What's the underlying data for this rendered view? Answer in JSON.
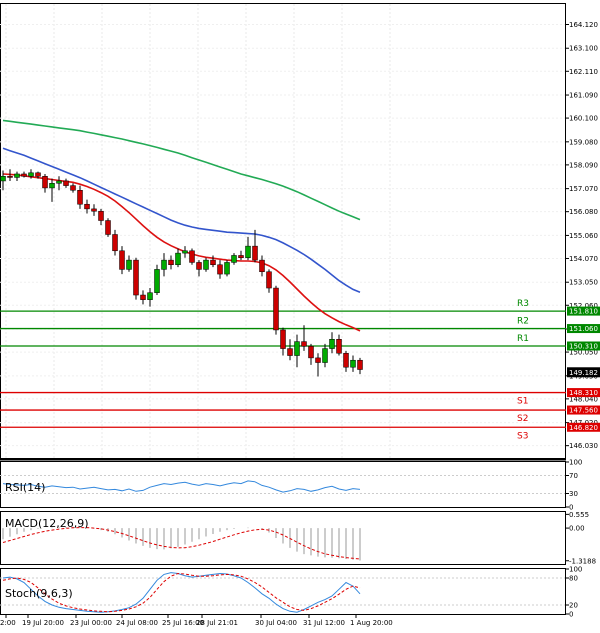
{
  "chart_data": {
    "type": "candlestick",
    "price": {
      "ylim": [
        145.5,
        165.0
      ],
      "yticks": [
        "164.120",
        "163.100",
        "162.110",
        "161.090",
        "160.100",
        "159.080",
        "158.090",
        "157.070",
        "156.080",
        "155.060",
        "154.070",
        "153.050",
        "152.060",
        "151.040",
        "150.050",
        "149.030",
        "148.040",
        "147.020",
        "146.030"
      ],
      "xlabels": [
        "2:00",
        "19 Jul 20:00",
        "23 Jul 00:00",
        "24 Jul 08:00",
        "25 Jul 16:00",
        "28 Jul 21:01",
        "30 Jul 04:00",
        "31 Jul 12:00",
        "1 Aug 20:00"
      ],
      "candles": [
        [
          157.4,
          157.85,
          157.0,
          157.6
        ],
        [
          157.6,
          157.9,
          157.4,
          157.55
        ],
        [
          157.55,
          157.8,
          157.4,
          157.7
        ],
        [
          157.7,
          157.8,
          157.55,
          157.6
        ],
        [
          157.6,
          157.9,
          157.5,
          157.75
        ],
        [
          157.75,
          157.8,
          157.5,
          157.6
        ],
        [
          157.6,
          157.7,
          156.9,
          157.1
        ],
        [
          157.1,
          157.5,
          156.5,
          157.3
        ],
        [
          157.3,
          157.6,
          157.0,
          157.4
        ],
        [
          157.4,
          157.5,
          157.1,
          157.2
        ],
        [
          157.2,
          157.3,
          156.9,
          157.0
        ],
        [
          157.0,
          157.2,
          156.2,
          156.4
        ],
        [
          156.4,
          156.6,
          156.0,
          156.2
        ],
        [
          156.2,
          156.4,
          155.9,
          156.1
        ],
        [
          156.1,
          156.2,
          155.5,
          155.7
        ],
        [
          155.7,
          155.8,
          155.0,
          155.1
        ],
        [
          155.1,
          155.3,
          154.2,
          154.4
        ],
        [
          154.4,
          154.6,
          153.4,
          153.6
        ],
        [
          153.6,
          154.2,
          153.5,
          154.0
        ],
        [
          154.0,
          154.1,
          152.3,
          152.5
        ],
        [
          152.5,
          152.7,
          152.1,
          152.3
        ],
        [
          152.3,
          152.8,
          152.0,
          152.6
        ],
        [
          152.6,
          153.8,
          152.5,
          153.6
        ],
        [
          153.6,
          154.3,
          153.3,
          154.0
        ],
        [
          154.0,
          154.2,
          153.6,
          153.8
        ],
        [
          153.8,
          154.5,
          153.7,
          154.3
        ],
        [
          154.3,
          154.6,
          154.1,
          154.4
        ],
        [
          154.4,
          154.5,
          153.8,
          153.9
        ],
        [
          153.9,
          154.0,
          153.3,
          153.6
        ],
        [
          153.6,
          154.1,
          153.5,
          154.0
        ],
        [
          154.0,
          154.2,
          153.7,
          153.8
        ],
        [
          153.8,
          154.0,
          153.2,
          153.4
        ],
        [
          153.4,
          154.0,
          153.3,
          153.9
        ],
        [
          153.9,
          154.3,
          153.8,
          154.2
        ],
        [
          154.2,
          154.4,
          154.0,
          154.1
        ],
        [
          154.1,
          155.0,
          154.0,
          154.6
        ],
        [
          154.6,
          155.3,
          153.9,
          154.0
        ],
        [
          154.0,
          154.2,
          153.3,
          153.5
        ],
        [
          153.5,
          153.6,
          152.6,
          152.8
        ],
        [
          152.8,
          152.9,
          150.8,
          151.0
        ],
        [
          151.0,
          151.1,
          149.9,
          150.2
        ],
        [
          150.2,
          150.6,
          149.7,
          149.9
        ],
        [
          149.9,
          150.8,
          149.4,
          150.5
        ],
        [
          150.5,
          151.2,
          150.1,
          150.3
        ],
        [
          150.3,
          150.4,
          149.5,
          149.8
        ],
        [
          149.8,
          150.0,
          149.0,
          149.6
        ],
        [
          149.6,
          150.4,
          149.4,
          150.2
        ],
        [
          150.2,
          150.9,
          150.0,
          150.6
        ],
        [
          150.6,
          150.8,
          149.9,
          150.0
        ],
        [
          150.0,
          150.1,
          149.2,
          149.4
        ],
        [
          149.4,
          149.9,
          149.2,
          149.7
        ],
        [
          149.7,
          149.8,
          149.1,
          149.3
        ]
      ],
      "ma_slow": {
        "color": "#22aa55",
        "values": [
          160.0,
          159.96,
          159.92,
          159.88,
          159.84,
          159.8,
          159.76,
          159.72,
          159.68,
          159.64,
          159.6,
          159.56,
          159.5,
          159.44,
          159.38,
          159.32,
          159.26,
          159.2,
          159.13,
          159.06,
          158.99,
          158.92,
          158.84,
          158.76,
          158.68,
          158.6,
          158.5,
          158.4,
          158.3,
          158.2,
          158.1,
          158.0,
          157.9,
          157.8,
          157.7,
          157.62,
          157.54,
          157.46,
          157.37,
          157.28,
          157.18,
          157.06,
          156.94,
          156.8,
          156.66,
          156.52,
          156.38,
          156.24,
          156.1,
          155.98,
          155.86,
          155.74
        ]
      },
      "ma_mid": {
        "color": "#3355cc",
        "values": [
          158.8,
          158.7,
          158.6,
          158.5,
          158.38,
          158.26,
          158.14,
          158.02,
          157.9,
          157.78,
          157.66,
          157.54,
          157.4,
          157.26,
          157.12,
          156.98,
          156.84,
          156.7,
          156.56,
          156.42,
          156.28,
          156.14,
          156.0,
          155.86,
          155.72,
          155.6,
          155.5,
          155.42,
          155.36,
          155.32,
          155.28,
          155.24,
          155.2,
          155.18,
          155.16,
          155.14,
          155.12,
          155.06,
          154.98,
          154.88,
          154.74,
          154.58,
          154.42,
          154.24,
          154.04,
          153.82,
          153.6,
          153.36,
          153.12,
          152.92,
          152.74,
          152.62
        ]
      },
      "ma_fast": {
        "color": "#dd1111",
        "values": [
          157.7,
          157.68,
          157.66,
          157.62,
          157.58,
          157.54,
          157.5,
          157.46,
          157.42,
          157.38,
          157.34,
          157.26,
          157.16,
          157.04,
          156.9,
          156.74,
          156.54,
          156.3,
          156.04,
          155.76,
          155.48,
          155.22,
          154.98,
          154.78,
          154.62,
          154.48,
          154.36,
          154.26,
          154.18,
          154.12,
          154.08,
          154.04,
          154.0,
          153.98,
          153.96,
          153.96,
          153.94,
          153.88,
          153.76,
          153.58,
          153.34,
          153.06,
          152.76,
          152.46,
          152.18,
          151.92,
          151.7,
          151.52,
          151.36,
          151.22,
          151.1,
          150.96
        ]
      },
      "resistance": [
        {
          "label": "R3",
          "value": "151.810",
          "v": 151.81
        },
        {
          "label": "R2",
          "value": "151.060",
          "v": 151.06
        },
        {
          "label": "R1",
          "value": "150.310",
          "v": 150.31
        }
      ],
      "support": [
        {
          "label": "S1",
          "value": "148.310",
          "v": 148.31
        },
        {
          "label": "S2",
          "value": "147.560",
          "v": 147.56
        },
        {
          "label": "S3",
          "value": "146.820",
          "v": 146.82
        }
      ],
      "current": {
        "value": "149.182",
        "v": 149.182
      },
      "resistance_color": "#008800",
      "support_color": "#dd0000",
      "bull_color": "#00aa00",
      "bear_color": "#cc0000"
    },
    "rsi": {
      "title": "RSI(14)",
      "yticks": [
        "100",
        "70",
        "30",
        "0"
      ],
      "ylim": [
        0,
        100
      ],
      "color": "#3388dd",
      "values": [
        52,
        50,
        49,
        48,
        50,
        46,
        44,
        47,
        45,
        43,
        44,
        40,
        42,
        44,
        41,
        38,
        39,
        36,
        40,
        35,
        37,
        44,
        48,
        52,
        50,
        53,
        55,
        51,
        48,
        52,
        50,
        47,
        51,
        54,
        52,
        58,
        56,
        48,
        44,
        38,
        33,
        36,
        41,
        39,
        35,
        38,
        43,
        46,
        40,
        37,
        41,
        39
      ]
    },
    "macd": {
      "title": "MACD(12,26,9)",
      "yticks": [
        "0.555",
        "0.00",
        "-1.3188"
      ],
      "ylim": [
        -1.45,
        0.65
      ],
      "signal_color": "#dd0000",
      "hist": [
        -0.45,
        -0.35,
        -0.25,
        -0.15,
        -0.08,
        -0.03,
        0.0,
        0.02,
        0.03,
        0.04,
        0.05,
        0.04,
        0.02,
        -0.02,
        -0.08,
        -0.15,
        -0.25,
        -0.38,
        -0.5,
        -0.62,
        -0.72,
        -0.8,
        -0.85,
        -0.86,
        -0.82,
        -0.76,
        -0.66,
        -0.55,
        -0.45,
        -0.34,
        -0.24,
        -0.15,
        -0.08,
        -0.03,
        0.0,
        0.02,
        0.0,
        -0.05,
        -0.18,
        -0.4,
        -0.62,
        -0.8,
        -0.95,
        -1.05,
        -1.1,
        -1.15,
        -1.18,
        -1.2,
        -1.22,
        -1.25,
        -1.28,
        -1.31
      ],
      "signal": [
        -0.58,
        -0.5,
        -0.42,
        -0.34,
        -0.26,
        -0.19,
        -0.13,
        -0.08,
        -0.04,
        -0.01,
        0.01,
        0.02,
        0.02,
        0.0,
        -0.03,
        -0.08,
        -0.14,
        -0.22,
        -0.31,
        -0.41,
        -0.51,
        -0.6,
        -0.68,
        -0.74,
        -0.78,
        -0.8,
        -0.79,
        -0.75,
        -0.69,
        -0.62,
        -0.54,
        -0.45,
        -0.36,
        -0.27,
        -0.19,
        -0.12,
        -0.07,
        -0.05,
        -0.08,
        -0.16,
        -0.28,
        -0.42,
        -0.57,
        -0.71,
        -0.84,
        -0.95,
        -1.04,
        -1.1,
        -1.15,
        -1.19,
        -1.22,
        -1.25
      ]
    },
    "stoch": {
      "title": "Stoch(9,6,3)",
      "yticks": [
        "100",
        "80",
        "20",
        "0"
      ],
      "ylim": [
        0,
        100
      ],
      "k_color": "#3388dd",
      "d_color": "#dd0000",
      "k": [
        80,
        82,
        78,
        70,
        55,
        40,
        28,
        20,
        15,
        12,
        10,
        8,
        6,
        5,
        4,
        5,
        7,
        10,
        14,
        22,
        35,
        55,
        75,
        88,
        92,
        90,
        85,
        82,
        84,
        86,
        88,
        90,
        89,
        85,
        80,
        70,
        58,
        45,
        35,
        22,
        12,
        6,
        4,
        10,
        18,
        26,
        32,
        40,
        55,
        70,
        62,
        45
      ],
      "d": [
        75,
        78,
        80,
        77,
        70,
        58,
        45,
        33,
        24,
        18,
        14,
        11,
        9,
        7,
        6,
        5,
        6,
        8,
        11,
        16,
        24,
        37,
        55,
        72,
        84,
        90,
        89,
        86,
        84,
        84,
        85,
        87,
        88,
        87,
        84,
        78,
        70,
        60,
        48,
        36,
        26,
        16,
        10,
        8,
        12,
        18,
        26,
        34,
        44,
        55,
        62,
        58
      ]
    }
  }
}
